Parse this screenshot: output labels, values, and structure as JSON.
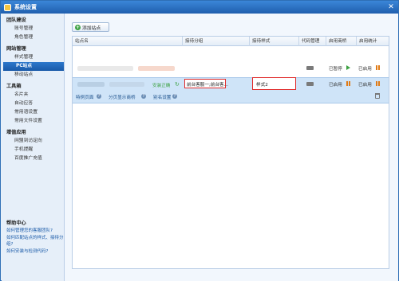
{
  "window": {
    "title": "系统设置",
    "close_glyph": "✕"
  },
  "sidebar": {
    "groups": [
      {
        "title": "团队建设",
        "items": [
          "账号管理",
          "角色管理"
        ]
      },
      {
        "title": "网站管理",
        "items": [
          "样式管理",
          "PC站点",
          "移动站点"
        ]
      },
      {
        "title": "工具箱",
        "items": [
          "名片夹",
          "自动应答",
          "常用语设置",
          "常用文件设置"
        ]
      },
      {
        "title": "增值应用",
        "items": [
          "网盟到访定向",
          "手机提醒",
          "百度推广充值"
        ]
      }
    ],
    "active_item": "PC站点"
  },
  "help": {
    "title": "帮助中心",
    "links": [
      "如何管理您的客服团队?",
      "如何匹配站点的样式、接待分组?",
      "如何安装与检测代码?"
    ]
  },
  "toolbar": {
    "add_button": "添加站点"
  },
  "table": {
    "headers": [
      "站点名",
      "接待分组",
      "接待样式",
      "代码管理",
      "启用商桥",
      "启用统计"
    ],
    "rows": [
      {
        "status": "",
        "group": "",
        "style": "",
        "bridge": "已暂停",
        "stats": "已启用"
      },
      {
        "status": "安装正确",
        "group": "前台客服一;前台客...",
        "style": "样式2",
        "bridge": "已启用",
        "stats": "已启用",
        "links": [
          "特例页面",
          "分页显示商桥",
          "别名设置"
        ]
      }
    ]
  },
  "colors": {
    "accent": "#1f5fae",
    "selected_row": "#cfe4f8",
    "highlight": "#e02a2a",
    "ok": "#3ea243"
  }
}
